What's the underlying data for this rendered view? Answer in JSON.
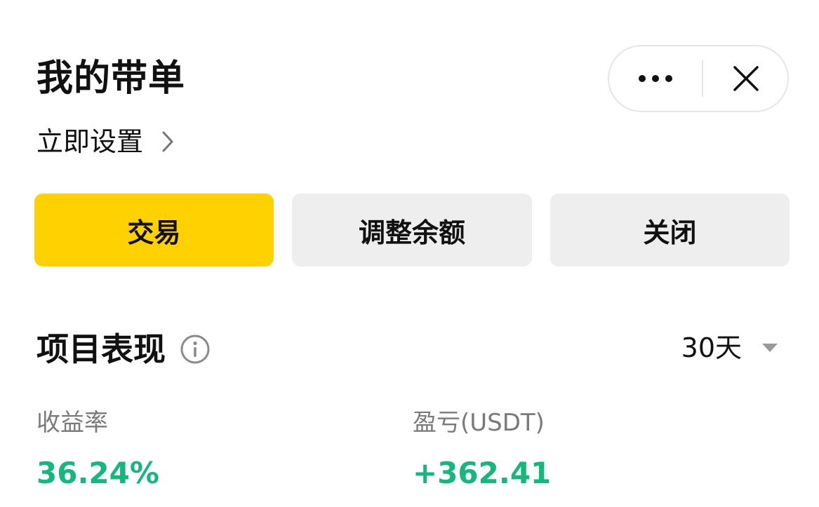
{
  "header": {
    "title": "我的带单",
    "setup_link": "立即设置"
  },
  "capsule": {
    "more_icon": "more-dots-icon",
    "close_icon": "close-icon"
  },
  "actions": {
    "trade": "交易",
    "adjust_balance": "调整余额",
    "close": "关闭"
  },
  "performance": {
    "title": "项目表现",
    "info_icon": "info-icon",
    "period": "30天",
    "period_icon": "caret-down-icon",
    "metrics": [
      {
        "label": "收益率",
        "value": "36.24%"
      },
      {
        "label": "盈亏(USDT)",
        "value": "+362.41"
      }
    ]
  },
  "colors": {
    "accent_yellow": "#ffd100",
    "secondary_button": "#eeeeee",
    "positive_green": "#14b87c",
    "muted_text": "#7a7a7a"
  }
}
